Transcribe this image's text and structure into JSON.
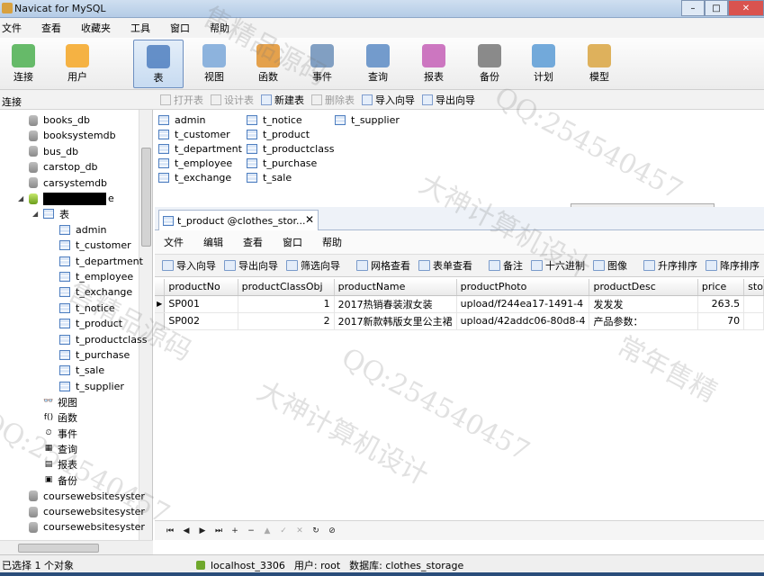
{
  "window": {
    "title": "Navicat for MySQL",
    "controls": [
      "–",
      "□",
      "✕"
    ]
  },
  "menu": [
    "文件",
    "查看",
    "收藏夹",
    "工具",
    "窗口",
    "帮助"
  ],
  "toolbar": [
    {
      "label": "连接",
      "icon": "connect-icon",
      "color": "#4caf50"
    },
    {
      "label": "用户",
      "icon": "user-icon",
      "color": "#f5a623"
    },
    {
      "label": "表",
      "icon": "table-icon",
      "color": "#4f7fc0",
      "active": true
    },
    {
      "label": "视图",
      "icon": "view-icon",
      "color": "#7aa7d8"
    },
    {
      "label": "函数",
      "icon": "function-icon",
      "color": "#e0922e"
    },
    {
      "label": "事件",
      "icon": "event-icon",
      "color": "#6c8fb9"
    },
    {
      "label": "查询",
      "icon": "query-icon",
      "color": "#5c8bc4"
    },
    {
      "label": "报表",
      "icon": "report-icon",
      "color": "#c45fb6"
    },
    {
      "label": "备份",
      "icon": "backup-icon",
      "color": "#777777"
    },
    {
      "label": "计划",
      "icon": "schedule-icon",
      "color": "#5b9bd5"
    },
    {
      "label": "模型",
      "icon": "model-icon",
      "color": "#d9a441"
    }
  ],
  "conn_label": "连接",
  "object_toolbar": [
    {
      "label": "打开表",
      "enabled": false
    },
    {
      "label": "设计表",
      "enabled": false
    },
    {
      "label": "新建表",
      "enabled": true
    },
    {
      "label": "删除表",
      "enabled": false
    },
    {
      "label": "导入向导",
      "enabled": true
    },
    {
      "label": "导出向导",
      "enabled": true
    }
  ],
  "tree": {
    "databases_top": [
      "books_db",
      "booksystemdb",
      "bus_db",
      "carstop_db",
      "carsystemdb"
    ],
    "open_db_suffix": "e",
    "tables_node": "表",
    "tables": [
      "admin",
      "t_customer",
      "t_department",
      "t_employee",
      "t_exchange",
      "t_notice",
      "t_product",
      "t_productclass",
      "t_purchase",
      "t_sale",
      "t_supplier"
    ],
    "groups": [
      {
        "label": "视图",
        "icon": "view-icon",
        "glyph": "👓"
      },
      {
        "label": "函数",
        "icon": "function-icon",
        "glyph": "f()"
      },
      {
        "label": "事件",
        "icon": "event-icon",
        "glyph": "⏲"
      },
      {
        "label": "查询",
        "icon": "query-icon",
        "glyph": "▦"
      },
      {
        "label": "报表",
        "icon": "report-icon",
        "glyph": "▤"
      },
      {
        "label": "备份",
        "icon": "backup-icon",
        "glyph": "▣"
      }
    ],
    "databases_bottom": [
      "coursewebsitesyster",
      "coursewebsitesyster",
      "coursewebsitesyster"
    ]
  },
  "object_list": [
    "admin",
    "t_customer",
    "t_department",
    "t_employee",
    "t_exchange",
    "t_notice",
    "t_product",
    "t_productclass",
    "t_purchase",
    "t_sale",
    "t_supplier"
  ],
  "tab": {
    "label": "t_product @clothes_stor...",
    "close": "✕"
  },
  "tab_menu": [
    "文件",
    "编辑",
    "查看",
    "窗口",
    "帮助"
  ],
  "data_toolbar": [
    "导入向导",
    "导出向导",
    "筛选向导",
    "网格查看",
    "表单查看",
    "备注",
    "十六进制",
    "图像",
    "升序排序",
    "降序排序"
  ],
  "grid": {
    "columns": [
      "productNo",
      "productClassObj",
      "productName",
      "productPhoto",
      "productDesc",
      "price",
      "sto"
    ],
    "rows": [
      [
        "SP001",
        "1",
        "2017热销春装淑女装",
        "upload/f244ea17-1491-4",
        "发发发",
        "263.5",
        ""
      ],
      [
        "SP002",
        "2",
        "2017新款韩版女里公主裙",
        "upload/42addc06-80d8-4",
        "产品参数：",
        "70",
        ""
      ]
    ]
  },
  "nav_buttons": [
    "⏮",
    "◀",
    "▶",
    "⏭",
    "+",
    "−",
    "▲",
    "✓",
    "✕",
    "↻",
    "⊘"
  ],
  "status": {
    "selection": "已选择 1 个对象",
    "connection": "localhost_3306",
    "user": "用户: root",
    "database": "数据库: clothes_storage"
  },
  "watermarks": [
    "售精品源码",
    "QQ:254540457",
    "大神计算机设计",
    "常年售精",
    "QQ:254540457",
    "大神计算机设计",
    "售精品源码",
    "QQ:254540457"
  ]
}
